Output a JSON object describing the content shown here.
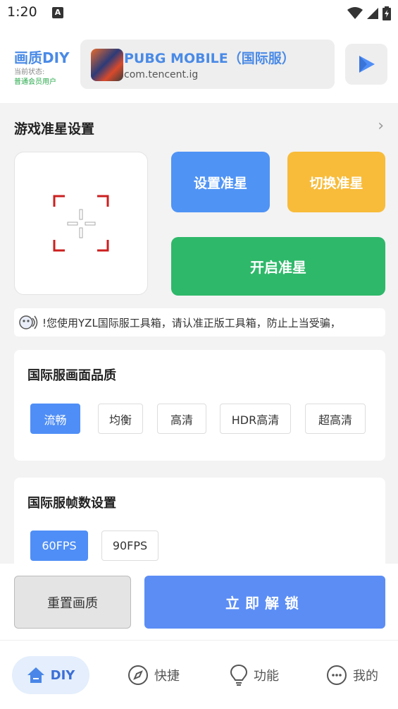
{
  "status_bar": {
    "time": "1:20",
    "badge": "A"
  },
  "header": {
    "brand_title": "画质DIY",
    "status_label": "当前状态:",
    "user_status": "普通会员用户",
    "app_name": "PUBG MOBILE（国际服）",
    "app_package": "com.tencent.ig"
  },
  "crosshair_section": {
    "title": "游戏准星设置",
    "set_button": "设置准星",
    "switch_button": "切换准星",
    "enable_button": "开启准星"
  },
  "notice": {
    "text": "!您使用YZL国际服工具箱，请认准正版工具箱，防止上当受骗，"
  },
  "quality": {
    "title": "国际服画面品质",
    "options": [
      "流畅",
      "均衡",
      "高清",
      "HDR高清",
      "超高清"
    ],
    "selected": "流畅"
  },
  "fps": {
    "title": "国际服帧数设置",
    "options": [
      "60FPS",
      "90FPS"
    ],
    "selected": "60FPS"
  },
  "actions": {
    "reset_label": "重置画质",
    "unlock_label": "立即解锁"
  },
  "nav": {
    "items": [
      {
        "label": "DIY",
        "icon": "home-icon",
        "active": true
      },
      {
        "label": "快捷",
        "icon": "compass-icon",
        "active": false
      },
      {
        "label": "功能",
        "icon": "lightbulb-icon",
        "active": false
      },
      {
        "label": "我的",
        "icon": "profile-icon",
        "active": false
      }
    ]
  },
  "colors": {
    "accent": "#4f8ef6",
    "set_button": "#4f93f5",
    "switch_button": "#f8bc3a",
    "enable_button": "#2eb86a",
    "unlock_button": "#5b8df5",
    "crosshair": "#cc1f1f"
  }
}
